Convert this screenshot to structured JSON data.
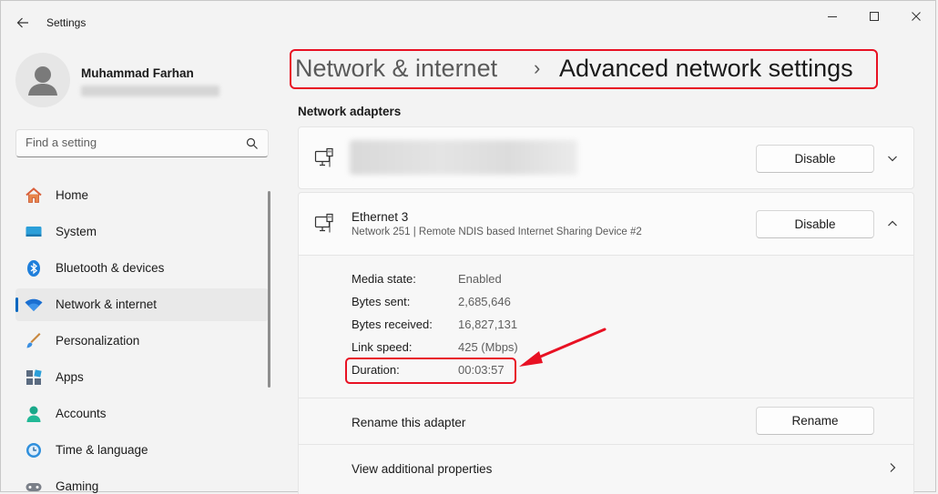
{
  "app": {
    "title": "Settings"
  },
  "profile": {
    "name": "Muhammad Farhan"
  },
  "search": {
    "placeholder": "Find a setting"
  },
  "nav": {
    "items": [
      {
        "label": "Home",
        "icon": "home-icon"
      },
      {
        "label": "System",
        "icon": "system-icon"
      },
      {
        "label": "Bluetooth & devices",
        "icon": "bluetooth-icon"
      },
      {
        "label": "Network & internet",
        "icon": "wifi-icon",
        "selected": true
      },
      {
        "label": "Personalization",
        "icon": "brush-icon"
      },
      {
        "label": "Apps",
        "icon": "apps-icon"
      },
      {
        "label": "Accounts",
        "icon": "accounts-icon"
      },
      {
        "label": "Time & language",
        "icon": "time-icon"
      },
      {
        "label": "Gaming",
        "icon": "gaming-icon"
      }
    ]
  },
  "breadcrumb": {
    "parent": "Network & internet",
    "separator": "›",
    "current": "Advanced network settings"
  },
  "section": {
    "title": "Network adapters"
  },
  "adapters": [
    {
      "disable_label": "Disable"
    },
    {
      "name": "Ethernet 3",
      "description": "Network 251 | Remote NDIS based Internet Sharing Device #2",
      "disable_label": "Disable",
      "properties": [
        {
          "label": "Media state:",
          "value": "Enabled"
        },
        {
          "label": "Bytes sent:",
          "value": "2,685,646"
        },
        {
          "label": "Bytes received:",
          "value": "16,827,131"
        },
        {
          "label": "Link speed:",
          "value": "425 (Mbps)"
        },
        {
          "label": "Duration:",
          "value": "00:03:57"
        }
      ],
      "rename_row_label": "Rename this adapter",
      "rename_button": "Rename",
      "view_properties_label": "View additional properties"
    }
  ],
  "colors": {
    "accent": "#0067c0",
    "highlight": "#e81123",
    "background": "#f3f3f3",
    "card": "#fbfbfb"
  }
}
